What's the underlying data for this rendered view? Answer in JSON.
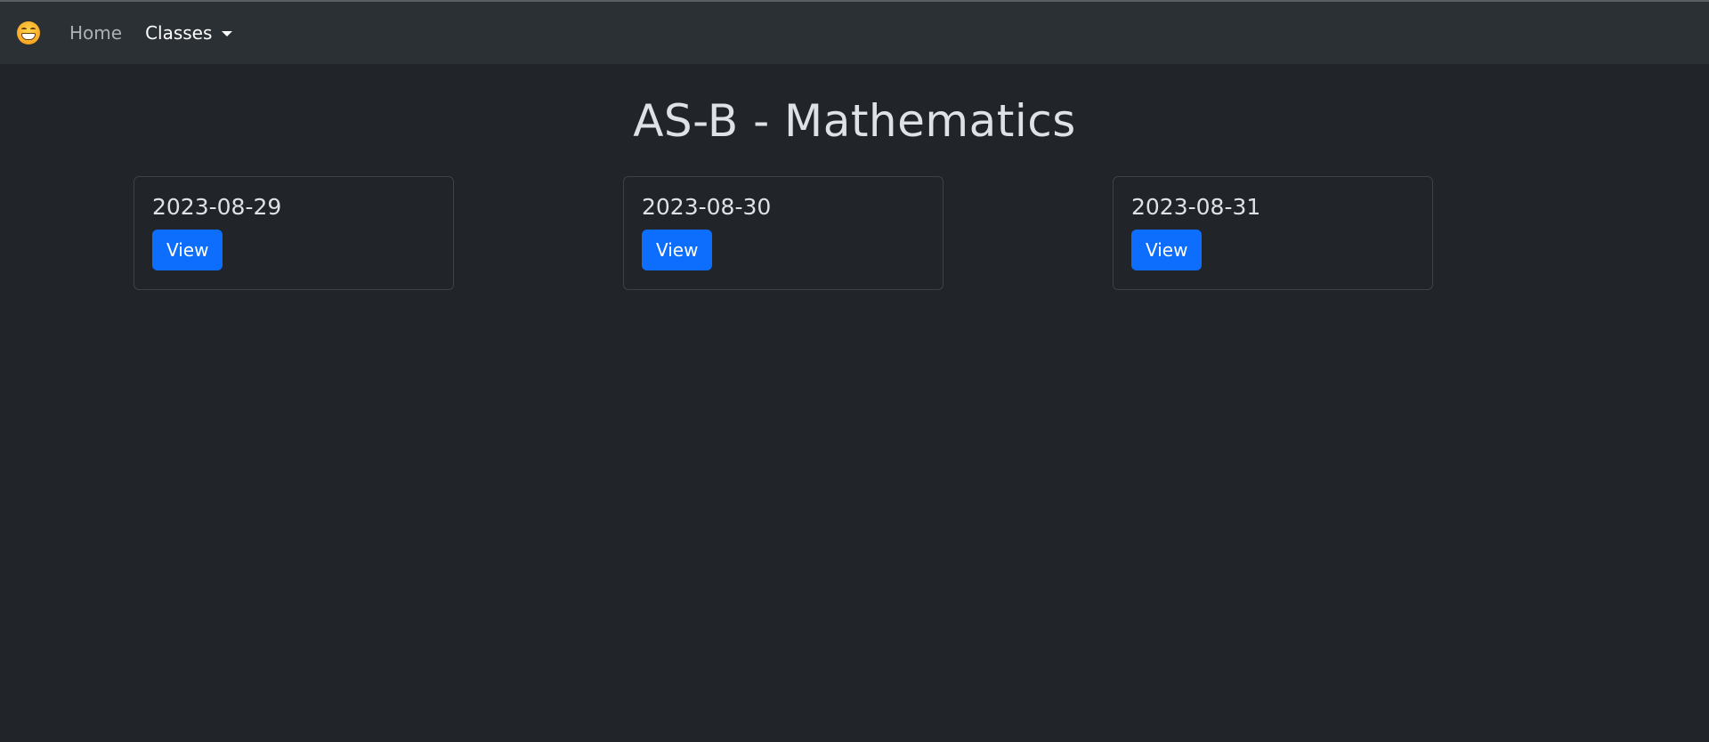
{
  "navbar": {
    "brand_icon": "grinning-face-icon",
    "items": [
      {
        "label": "Home"
      },
      {
        "label": "Classes"
      }
    ]
  },
  "page": {
    "title": "AS-B - Mathematics"
  },
  "cards": [
    {
      "date": "2023-08-29",
      "button_label": "View"
    },
    {
      "date": "2023-08-30",
      "button_label": "View"
    },
    {
      "date": "2023-08-31",
      "button_label": "View"
    }
  ],
  "colors": {
    "background": "#212529",
    "navbar": "#2b3035",
    "primary": "#0d6efd"
  }
}
